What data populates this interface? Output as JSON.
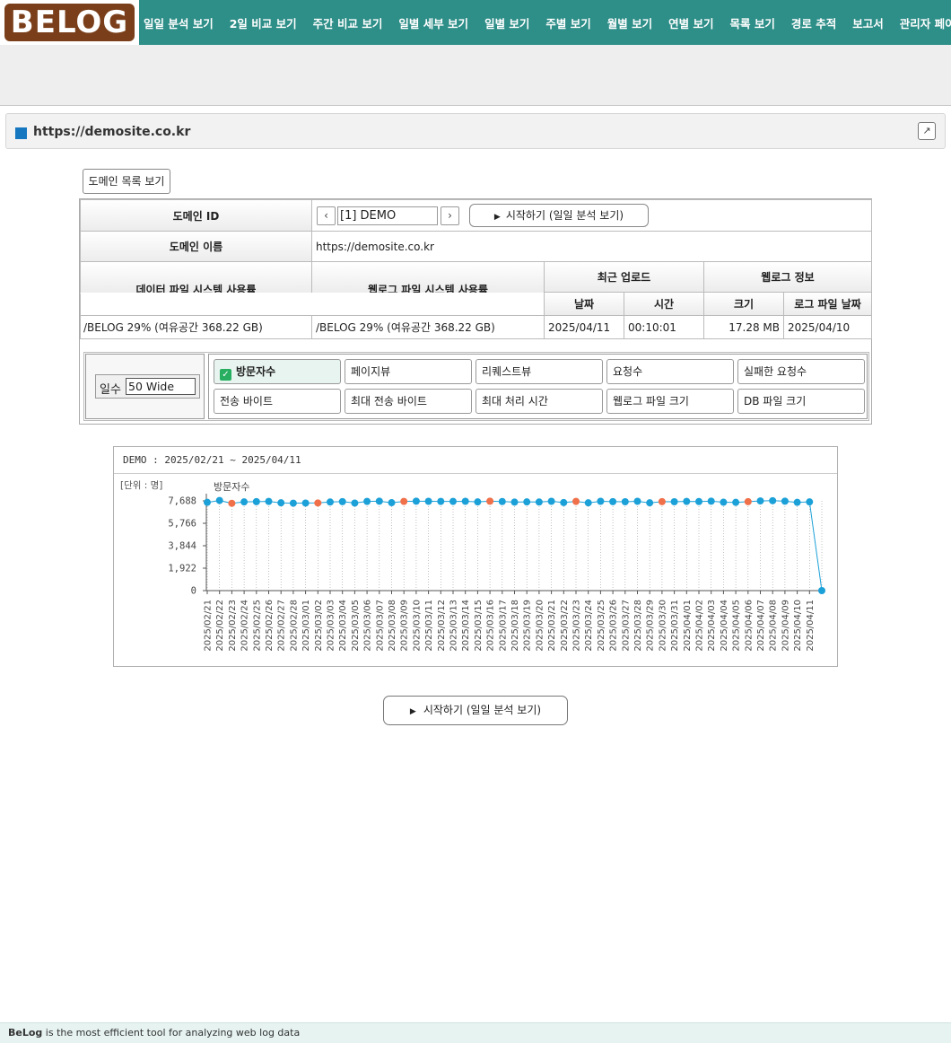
{
  "header": {
    "logo_text": "BELOG",
    "nav": [
      "일일 분석 보기",
      "2일 비교 보기",
      "주간 비교 보기",
      "일별 세부 보기",
      "일별 보기",
      "주별 보기",
      "월별 보기",
      "연별 보기",
      "목록 보기",
      "경로 추적",
      "보고서",
      "관리자 페이지"
    ]
  },
  "panel": {
    "title": "https://demosite.co.kr",
    "expand_icon": "external-link-icon"
  },
  "domain_list_button": "도메인 목록 보기",
  "info": {
    "domain_id_label": "도메인 ID",
    "domain_id_value": "[1] DEMO",
    "prev_icon": "‹",
    "next_icon": "›",
    "start_button": "시작하기 (일일 분석 보기)",
    "domain_name_label": "도메인 이름",
    "domain_name_value": "https://demosite.co.kr",
    "data_fs_label": "데이터 파일 시스템 사용률",
    "weblog_fs_label": "웹로그 파일 시스템 사용률",
    "recent_upload_label": "최근 업로드",
    "weblog_info_label": "웹로그 정보",
    "date_label": "날짜",
    "time_label": "시간",
    "size_label": "크기",
    "logfile_date_label": "로그 파일 날짜",
    "data_fs_value": "/BELOG 29% (여유공간 368.22 GB)",
    "weblog_fs_value": "/BELOG 29% (여유공간 368.22 GB)",
    "upload_date": "2025/04/11",
    "upload_time": "00:10:01",
    "log_size": "17.28 MB",
    "logfile_date": "2025/04/10"
  },
  "metrics": {
    "days_label": "일수",
    "days_value": "50 Wide",
    "buttons": [
      "방문자수",
      "페이지뷰",
      "리퀘스트뷰",
      "요청수",
      "실패한 요청수",
      "전송 바이트",
      "최대 전송 바이트",
      "최대 처리 시간",
      "웹로그 파일 크기",
      "DB 파일 크기"
    ],
    "selected": "방문자수"
  },
  "chart_data": {
    "type": "line",
    "title": "DEMO : 2025/02/21 ~ 2025/04/11",
    "unit_label": "[단위 : 명]",
    "series": [
      {
        "name": "방문자수",
        "values": [
          7560,
          7720,
          7480,
          7600,
          7620,
          7640,
          7520,
          7490,
          7500,
          7510,
          7590,
          7620,
          7500,
          7640,
          7660,
          7530,
          7640,
          7660,
          7650,
          7640,
          7640,
          7650,
          7600,
          7660,
          7630,
          7580,
          7600,
          7590,
          7650,
          7540,
          7640,
          7520,
          7650,
          7620,
          7610,
          7650,
          7520,
          7620,
          7610,
          7640,
          7630,
          7660,
          7570,
          7560,
          7620,
          7680,
          7700,
          7660,
          7560,
          7600,
          0
        ]
      }
    ],
    "weekend_color": "#f0704a",
    "point_color": "#1ba0d8",
    "highlight_indices": [
      2,
      9,
      16,
      23,
      30,
      37,
      44
    ],
    "x_start": "2025/02/21",
    "x_end": "2025/04/11",
    "y_ticks": [
      "7,688",
      "5,766",
      "3,844",
      "1,922",
      "0"
    ],
    "ylim": [
      0,
      7688
    ],
    "x": [
      "2025/02/21",
      "2025/02/22",
      "2025/02/23",
      "2025/02/24",
      "2025/02/25",
      "2025/02/26",
      "2025/02/27",
      "2025/02/28",
      "2025/03/01",
      "2025/03/02",
      "2025/03/03",
      "2025/03/04",
      "2025/03/05",
      "2025/03/06",
      "2025/03/07",
      "2025/03/08",
      "2025/03/09",
      "2025/03/10",
      "2025/03/11",
      "2025/03/12",
      "2025/03/13",
      "2025/03/14",
      "2025/03/15",
      "2025/03/16",
      "2025/03/17",
      "2025/03/18",
      "2025/03/19",
      "2025/03/20",
      "2025/03/21",
      "2025/03/22",
      "2025/03/23",
      "2025/03/24",
      "2025/03/25",
      "2025/03/26",
      "2025/03/27",
      "2025/03/28",
      "2025/03/29",
      "2025/03/30",
      "2025/03/31",
      "2025/04/01",
      "2025/04/02",
      "2025/04/03",
      "2025/04/04",
      "2025/04/05",
      "2025/04/06",
      "2025/04/07",
      "2025/04/08",
      "2025/04/09",
      "2025/04/10",
      "2025/04/11"
    ]
  },
  "bottom_start_button": "시작하기 (일일 분석 보기)",
  "footer": {
    "brand": "BeLog",
    "text": " is the most efficient tool for analyzing web log data"
  }
}
